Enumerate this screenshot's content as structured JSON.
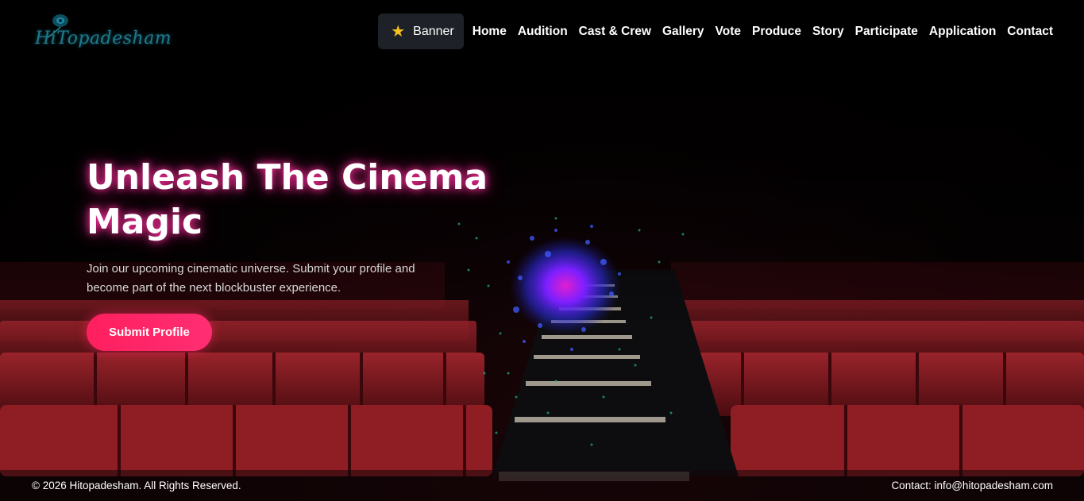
{
  "header": {
    "logo_text": "HiTopadesham",
    "banner_label": "Banner",
    "banner_icon": "star-icon",
    "nav_items": [
      "Home",
      "Audition",
      "Cast & Crew",
      "Gallery",
      "Vote",
      "Produce",
      "Story",
      "Participate",
      "Application",
      "Contact"
    ]
  },
  "hero": {
    "title": "Unleash The Cinema Magic",
    "subtitle": "Join our upcoming cinematic universe. Submit your profile and become part of the next blockbuster experience.",
    "cta_label": "Submit Profile"
  },
  "footer": {
    "copyright": "© 2026 Hitopadesham. All Rights Reserved.",
    "contact": "Contact: info@hitopadesham.com"
  },
  "colors": {
    "accent": "#ff2465",
    "title_glow": "#ff2d9b",
    "seat": "#8e1d24",
    "banner_bg": "#1e2228",
    "star": "#f6c21c"
  }
}
